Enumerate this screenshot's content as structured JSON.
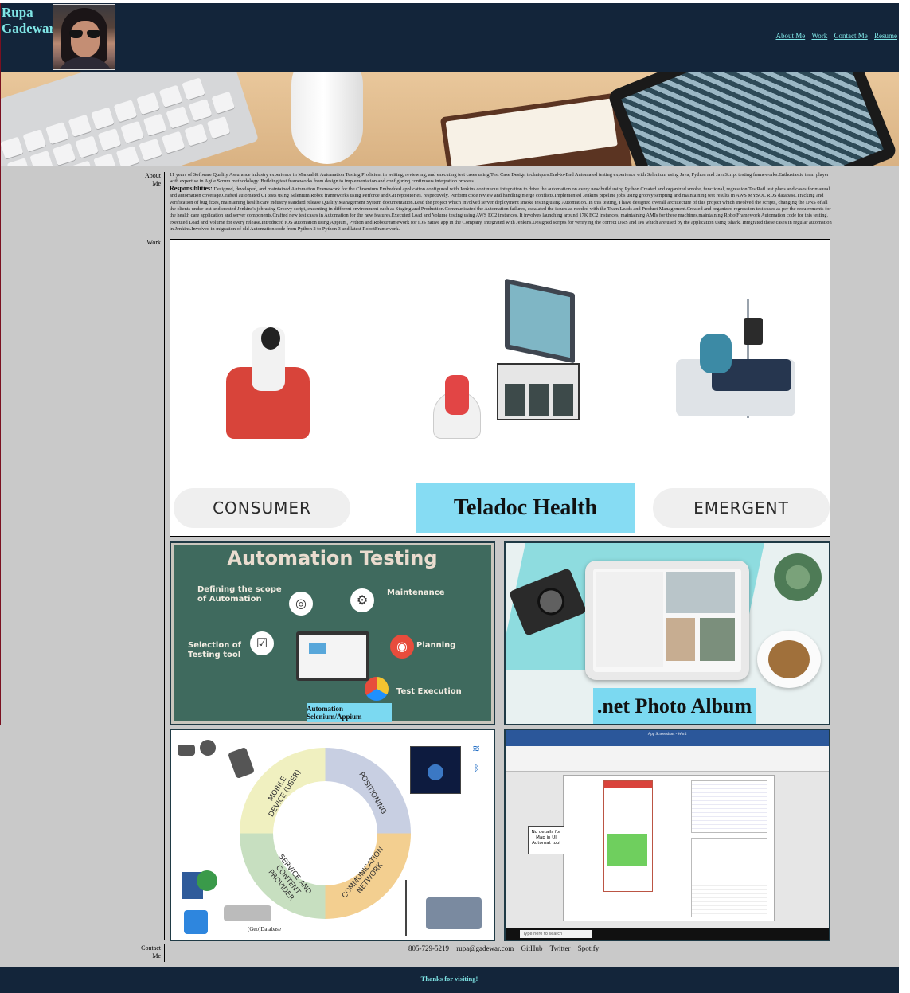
{
  "header": {
    "brand_line1": "Rupa",
    "brand_line2": "Gadewar",
    "nav": [
      "About Me",
      "Work",
      "Contact Me",
      "Resume"
    ]
  },
  "about": {
    "label_line1": "About",
    "label_line2": "Me",
    "summary": "11 years of Software Quality Assurance industry experience in Manual & Automation Testing.Proficient in writing, reviewing, and executing test cases using Test Case Design techniques.End-to-End Automated testing experience with Selenium using Java, Python and JavaScript testing frameworks.Enthusiastic team player with expertise in Agile Scrum methodology. Building test frameworks from design to implementation and configuring continuous integration process.",
    "resp_heading": "Responsiblities:",
    "responsibilities": "Designed, developed, and maintained Automation Framework for the Chromium Embedded application configured with Jenkins continuous integration to drive the automation on every new build using Python.Created and organized smoke, functional, regression TestRail test plans and cases for manual and automation coverage.Crafted automated UI tests using Selenium Robot frameworks using Perforce and Git repositories, respectively. Perform code review and handling merge conflicts.Implemented Jenkins pipeline jobs using groovy scripting and maintaining test results in AWS MYSQL RDS database.Tracking and verification of bug fixes, maintaining health care industry standard release Quality Management System documentation.Lead the project which involved server deployment smoke testing using Automation. In this testing, I have designed overall architecture of this project which involved the scripts, changing the DNS of all the clients under test and created Jenkins's job using Groovy script, executing in different environment such as Staging and Production.Communicated the Automation failures, escalated the issues as needed with the Team Leads and Product Management.Created and organized regression test cases as per the requirements for the health care application and server components.Crafted new test cases in Automation for the new features.Executed Load and Volume testing using AWS EC2 instances. It involves launching around 17K EC2 instances, maintaining AMIs for these machines,maintaining RobotFramework Automation code for this testing, executed Load and Volume for every release.Introduced iOS automation using Appium, Python and RobotFramework for iOS native app in the Company, integrated with Jenkins.Designed scripts for verifying the correct DNS and IPs which are used by the application using tshark. Integrated these cases in regular automation in Jenkins.Involved in migration of old Automation code from Python 2 to Python 3 and latest RobotFramework."
  },
  "work": {
    "label": "Work",
    "teladoc": {
      "pill_left": "CONSUMER",
      "center_label": "Teladoc Health",
      "pill_right": "EMERGENT"
    },
    "automation": {
      "title": "Automation Testing",
      "scope": "Defining the scope of Automation",
      "maintenance": "Maintenance",
      "selection": "Selection of Testing tool",
      "planning": "Planning",
      "execution": "Test Execution",
      "banner": "Automation Selenium/Appium"
    },
    "album": {
      "label": ".net Photo Album"
    },
    "positioning": {
      "mobile": "MOBILE DEVICE (USER)",
      "positioning": "POSITIONING",
      "service": "SERVICE AND CONTENT PROVIDER",
      "network": "COMMUNICATION NETWORK",
      "geo": "(Geo)Database"
    },
    "word": {
      "title": "App Screenshots - Word",
      "callout": "No details for Map in UI Automat tool",
      "search": "Type here to search"
    }
  },
  "contact": {
    "label_line1": "Contact",
    "label_line2": "Me",
    "links": [
      "805-729-5219",
      "rupa@gadewar.com",
      "GitHub",
      "Twitter",
      "Spotify"
    ]
  },
  "footer": {
    "text": "Thanks for visiting!"
  },
  "colors": {
    "header_bg": "#13253a",
    "accent": "#7fe5e5",
    "page_bg": "#c9c9c9",
    "label_blue": "#86dcf3"
  }
}
